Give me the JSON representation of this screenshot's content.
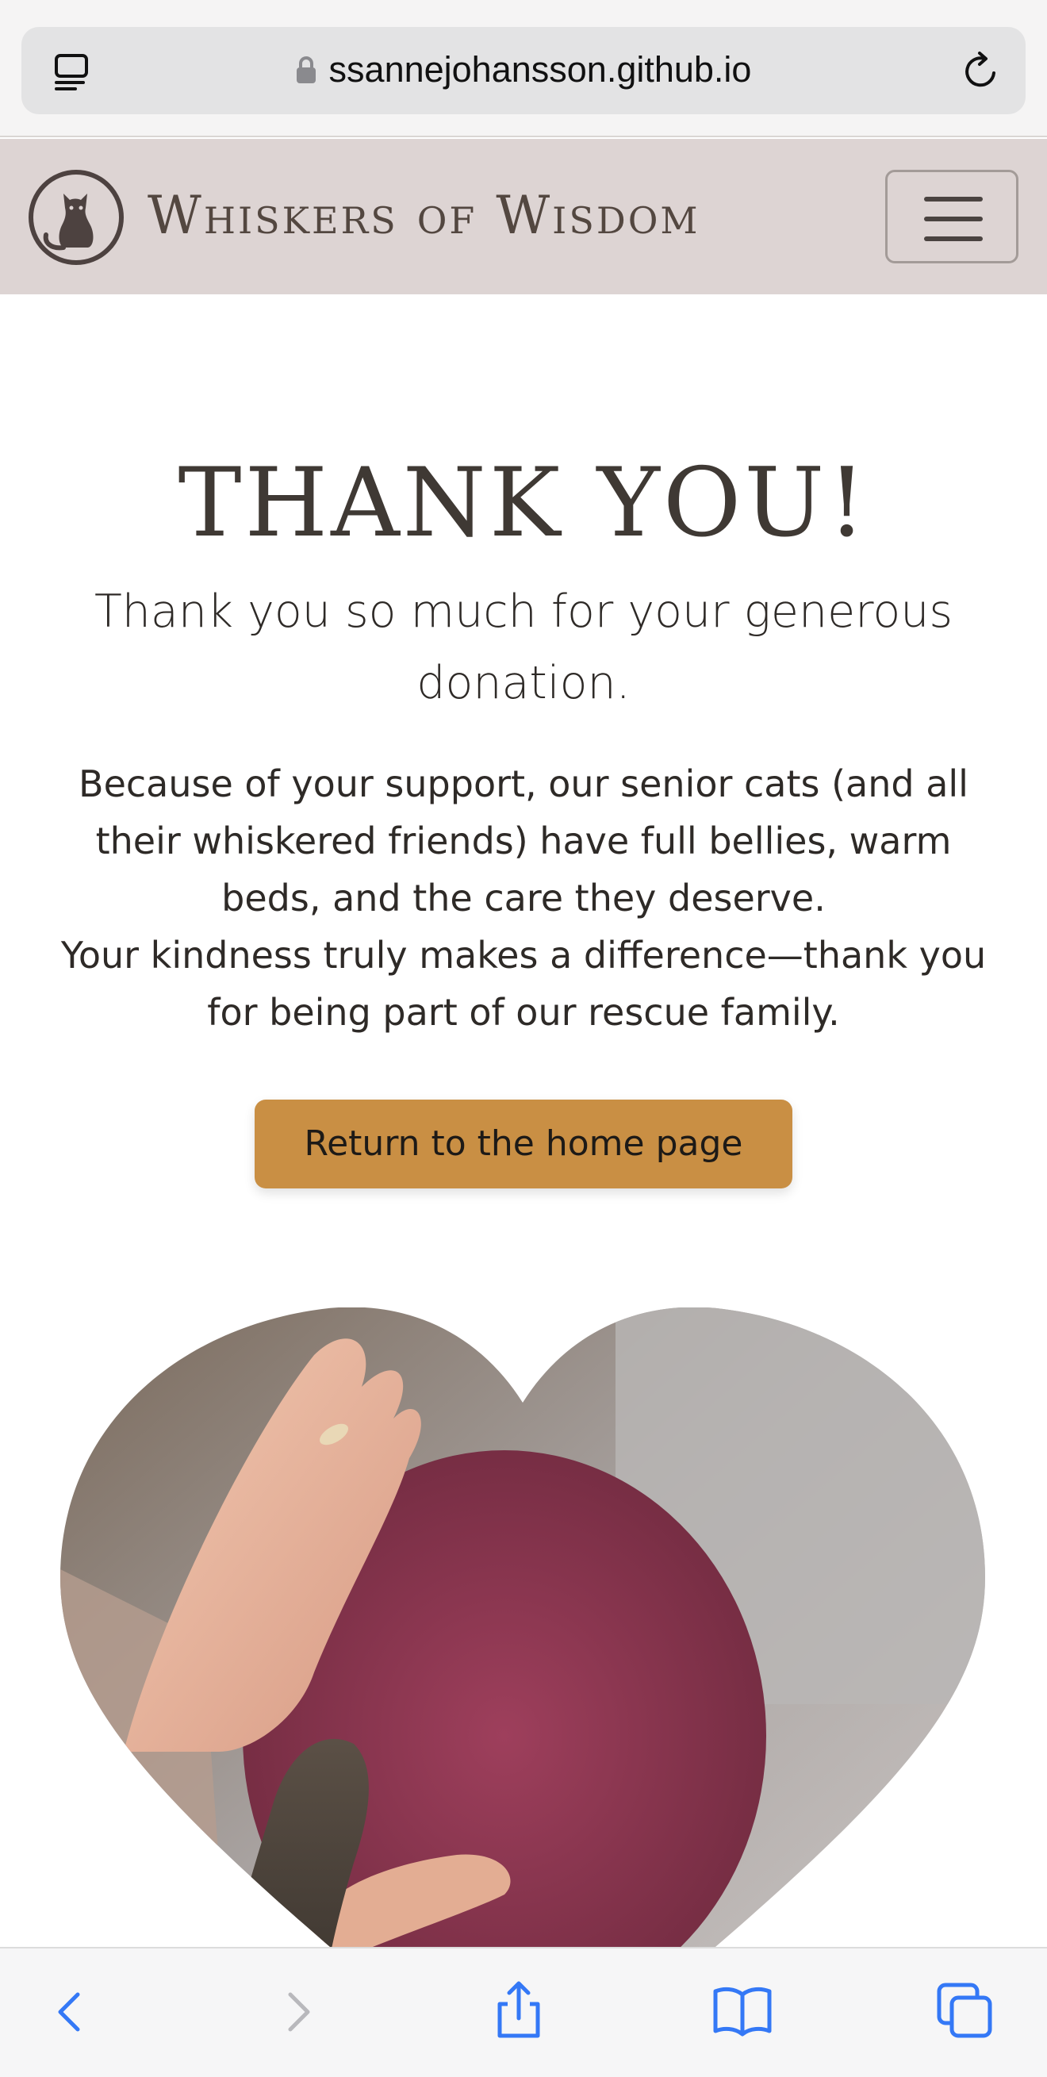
{
  "browser": {
    "url": "ssannejohansson.github.io",
    "icons": [
      "tab-overview-icon",
      "lock-icon",
      "reload-icon"
    ]
  },
  "header": {
    "brand": "Whiskers of Wisdom",
    "logo": "cat-logo",
    "menu_icon": "hamburger-menu-icon"
  },
  "main": {
    "title": "THANK YOU!",
    "subtitle": "Thank you so much for your generous donation.",
    "paragraph1": "Because of your support, our senior cats (and all their whiskered friends) have full bellies, warm beds, and the care they deserve.",
    "paragraph2": "Your kindness truly makes a difference—thank you for being part of our rescue family.",
    "button_label": "Return to the home page"
  },
  "toolbar": {
    "icons": [
      "back-icon",
      "forward-icon",
      "share-icon",
      "bookmarks-icon",
      "tabs-icon"
    ]
  },
  "colors": {
    "header_bg": "#ddd4d3",
    "button_bg": "#c98f44",
    "toolbar_accent": "#3478f6"
  }
}
